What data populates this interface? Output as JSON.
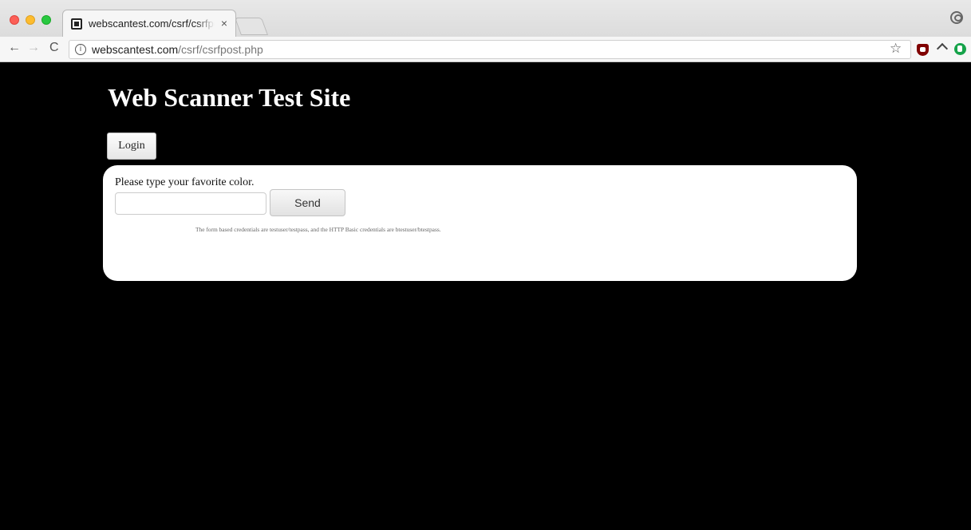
{
  "browser": {
    "tab_title": "webscantest.com/csrf/csrfpost.php",
    "tab_close": "×",
    "url_host": "webscantest.com",
    "url_path": "/csrf/csrfpost.php",
    "icons": {
      "back": "back-arrow-icon",
      "forward": "forward-arrow-icon",
      "reload": "reload-icon",
      "info": "info-icon",
      "bookmark": "star-icon",
      "profile": "profile-icon"
    }
  },
  "page": {
    "site_title": "Web Scanner Test Site",
    "login_label": "Login",
    "prompt": "Please type your favorite color.",
    "input_value": "",
    "send_label": "Send",
    "credentials_note": "The form based credentials are testuser/testpass, and the HTTP Basic credentials are btestuser/btestpass."
  }
}
